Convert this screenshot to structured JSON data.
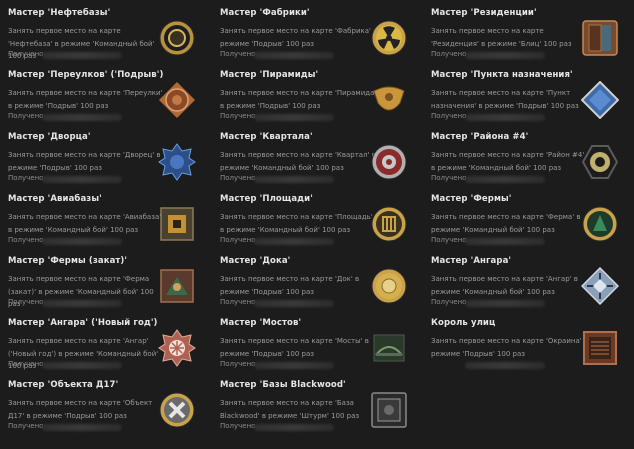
{
  "achievements": [
    {
      "title": "Мастер 'Нефтебазы'",
      "desc": "Занять первое место на карте 'Нефтебаза' в режиме 'Командный бой' 100 раз",
      "status": "Получено",
      "icon": "oil-base-medal-icon",
      "col": 0,
      "row": 0
    },
    {
      "title": "Мастер 'Фабрики'",
      "desc": "Занять первое место на карте 'Фабрика' в режиме 'Подрыв' 100 раз",
      "status": "Получено",
      "icon": "radiation-medal-icon",
      "col": 1,
      "row": 0
    },
    {
      "title": "Мастер 'Резиденции'",
      "desc": "Занять первое место на карте 'Резиденция' в режиме 'Блиц' 100 раз",
      "status": "Получено",
      "icon": "door-medal-icon",
      "col": 2,
      "row": 0
    },
    {
      "title": "Мастер 'Переулков' ('Подрыв')",
      "desc": "Занять первое место на карте 'Переулки' в режиме 'Подрыв' 100 раз",
      "status": "Получено",
      "icon": "alley-medal-icon",
      "col": 0,
      "row": 1
    },
    {
      "title": "Мастер 'Пирамиды'",
      "desc": "Занять первое место на карте 'Пирамида' в режиме 'Подрыв' 100 раз",
      "status": "Получено",
      "icon": "eagle-medal-icon",
      "col": 1,
      "row": 1
    },
    {
      "title": "Мастер 'Пункта назначения'",
      "desc": "Занять первое место на карте 'Пункт назначения' в режиме 'Подрыв' 100 раз",
      "status": "Получено",
      "icon": "destination-medal-icon",
      "col": 2,
      "row": 1
    },
    {
      "title": "Мастер 'Дворца'",
      "desc": "Занять первое место на карте 'Дворец' в режиме 'Подрыв' 100 раз",
      "status": "Получено",
      "icon": "palace-medal-icon",
      "col": 0,
      "row": 2
    },
    {
      "title": "Мастер 'Квартала'",
      "desc": "Занять первое место на карте 'Квартал' в режиме 'Командный бой' 100 раз",
      "status": "Получено",
      "icon": "quarter-medal-icon",
      "col": 1,
      "row": 2
    },
    {
      "title": "Мастер 'Района #4'",
      "desc": "Занять первое место на карте 'Район #4' в режиме 'Командный бой' 100 раз",
      "status": "Получено",
      "icon": "biohazard-medal-icon",
      "col": 2,
      "row": 2
    },
    {
      "title": "Мастер 'Авиабазы'",
      "desc": "Занять первое место на карте 'Авиабаза' в режиме 'Командный бой' 100 раз",
      "status": "Получено",
      "icon": "airbase-medal-icon",
      "col": 0,
      "row": 3
    },
    {
      "title": "Мастер 'Площади'",
      "desc": "Занять первое место на карте 'Площадь' в режиме 'Командный бой' 100 раз",
      "status": "Получено",
      "icon": "square-medal-icon",
      "col": 1,
      "row": 3
    },
    {
      "title": "Мастер 'Фермы'",
      "desc": "Занять первое место на карте 'Ферма' в режиме 'Командный бой' 100 раз",
      "status": "Получено",
      "icon": "farm-medal-icon",
      "col": 2,
      "row": 3
    },
    {
      "title": "Мастер 'Фермы (закат)'",
      "desc": "Занять первое место на карте 'Ферма (закат)' в режиме 'Командный бой' 100 раз",
      "status": "Получено",
      "icon": "farm-sunset-medal-icon",
      "col": 0,
      "row": 4
    },
    {
      "title": "Мастер 'Дока'",
      "desc": "Занять первое место на карте 'Док' в режиме 'Подрыв' 100 раз",
      "status": "Получено",
      "icon": "dock-medal-icon",
      "col": 1,
      "row": 4
    },
    {
      "title": "Мастер 'Ангара'",
      "desc": "Занять первое место на карте 'Ангар' в режиме 'Командный бой' 100 раз",
      "status": "Получено",
      "icon": "hangar-medal-icon",
      "col": 2,
      "row": 4
    },
    {
      "title": "Мастер 'Ангара' ('Новый год')",
      "desc": "Занять первое место на карте 'Ангар' ('Новый год') в режиме 'Командный бой' 100 раз",
      "status": "Получено",
      "icon": "snowflake-medal-icon",
      "col": 0,
      "row": 5
    },
    {
      "title": "Мастер 'Мостов'",
      "desc": "Занять первое место на карте 'Мосты' в режиме 'Подрыв' 100 раз",
      "status": "Получено",
      "icon": "bridge-medal-icon",
      "col": 1,
      "row": 5
    },
    {
      "title": "Король улиц",
      "desc": "Занять первое место на карте 'Окраина' в режиме 'Подрыв' 100 раз",
      "status": "",
      "icon": "street-king-medal-icon",
      "col": 2,
      "row": 5
    },
    {
      "title": "Мастер 'Объекта Д17'",
      "desc": "Занять первое место на карте 'Объект Д17' в режиме 'Подрыв' 100 раз",
      "status": "Получено",
      "icon": "object-d17-medal-icon",
      "col": 0,
      "row": 6
    },
    {
      "title": "Мастер 'Базы Blackwood'",
      "desc": "Занять первое место на карте 'База Blackwood' в режиме 'Штурм' 100 раз",
      "status": "Получено",
      "icon": "blackwood-medal-icon",
      "col": 1,
      "row": 6
    }
  ],
  "colors": {
    "background": "#1c1c1c",
    "title": "#e6e6e6",
    "text": "#9a9a9a",
    "gold": "#c9a24a"
  }
}
